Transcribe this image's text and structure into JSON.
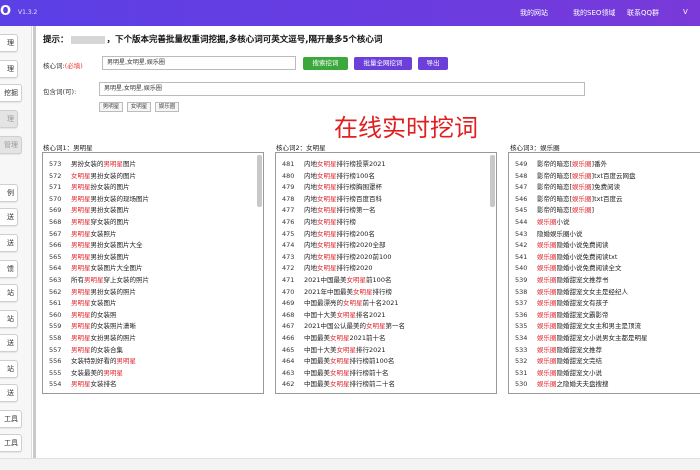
{
  "topbar": {
    "logo": "O",
    "version": "V1.3.2",
    "nav": [
      "我的网站",
      "我的SEO领域",
      "联系QQ群",
      "V"
    ]
  },
  "sidebar": {
    "labels": [
      "理",
      "理",
      "挖掘",
      "理",
      "管理",
      "例",
      "送",
      "送",
      "馈",
      "站",
      "站",
      "送",
      "站",
      "送",
      "工具",
      "工具"
    ]
  },
  "tip": {
    "prefix": "提示：",
    "text": "，下个版本完善批量权重词挖掘,多核心词可英文逗号,隔开最多5个核心词"
  },
  "form": {
    "core_label": "核心词:",
    "core_required": "(必填)",
    "core_value": "男明星,女明星,娱乐圈",
    "btn_search": "搜索挖词",
    "btn_batch": "批量全网挖词",
    "btn_export": "导出",
    "include_label": "包含词(可):",
    "include_value": "男明星,女明星,娱乐圈",
    "chips": [
      "男明星",
      "女明星",
      "娱乐圈"
    ]
  },
  "overlay_text": "在线实时挖词",
  "columns": [
    {
      "title": "核心词1：男明星",
      "rows": [
        {
          "n": "573",
          "parts": [
            {
              "t": "男扮女装的"
            },
            {
              "t": "男明星",
              "hl": true
            },
            {
              "t": "图片"
            }
          ]
        },
        {
          "n": "572",
          "parts": [
            {
              "t": "女明星",
              "hl": true
            },
            {
              "t": "男扮女装的图片"
            }
          ]
        },
        {
          "n": "571",
          "parts": [
            {
              "t": "男明星",
              "hl": true
            },
            {
              "t": "扮女装的图片"
            }
          ]
        },
        {
          "n": "570",
          "parts": [
            {
              "t": "男明星",
              "hl": true
            },
            {
              "t": "男扮女装的现场图片"
            }
          ]
        },
        {
          "n": "569",
          "parts": [
            {
              "t": "男明星",
              "hl": true
            },
            {
              "t": "男扮女装图片"
            }
          ]
        },
        {
          "n": "568",
          "parts": [
            {
              "t": "男明星",
              "hl": true
            },
            {
              "t": "穿女装的图片"
            }
          ]
        },
        {
          "n": "567",
          "parts": [
            {
              "t": "男明星",
              "hl": true
            },
            {
              "t": "女装照片"
            }
          ]
        },
        {
          "n": "566",
          "parts": [
            {
              "t": "男明星",
              "hl": true
            },
            {
              "t": "男扮女装图片大全"
            }
          ]
        },
        {
          "n": "565",
          "parts": [
            {
              "t": "男明星",
              "hl": true
            },
            {
              "t": "男扮女装图片"
            }
          ]
        },
        {
          "n": "564",
          "parts": [
            {
              "t": "男明星",
              "hl": true
            },
            {
              "t": "女装图片大全图片"
            }
          ]
        },
        {
          "n": "563",
          "parts": [
            {
              "t": "所有"
            },
            {
              "t": "男明星",
              "hl": true
            },
            {
              "t": "穿上女装的照片"
            }
          ]
        },
        {
          "n": "562",
          "parts": [
            {
              "t": "男明星",
              "hl": true
            },
            {
              "t": "男扮女装的照片"
            }
          ]
        },
        {
          "n": "561",
          "parts": [
            {
              "t": "男明星",
              "hl": true
            },
            {
              "t": "女装图片"
            }
          ]
        },
        {
          "n": "560",
          "parts": [
            {
              "t": "男明星",
              "hl": true
            },
            {
              "t": "的女装照"
            }
          ]
        },
        {
          "n": "559",
          "parts": [
            {
              "t": "男明星",
              "hl": true
            },
            {
              "t": "的女装照片潇晰"
            }
          ]
        },
        {
          "n": "558",
          "parts": [
            {
              "t": "男明星",
              "hl": true
            },
            {
              "t": "女扮男装的照片"
            }
          ]
        },
        {
          "n": "557",
          "parts": [
            {
              "t": "男明星",
              "hl": true
            },
            {
              "t": "的女装合集"
            }
          ]
        },
        {
          "n": "556",
          "parts": [
            {
              "t": "女装特别好看的"
            },
            {
              "t": "男明星",
              "hl": true
            }
          ]
        },
        {
          "n": "555",
          "parts": [
            {
              "t": "女装最美的"
            },
            {
              "t": "男明星",
              "hl": true
            }
          ]
        },
        {
          "n": "554",
          "parts": [
            {
              "t": "男明星",
              "hl": true
            },
            {
              "t": "女装排名"
            }
          ]
        }
      ]
    },
    {
      "title": "核心词2：女明星",
      "rows": [
        {
          "n": "481",
          "parts": [
            {
              "t": "内地"
            },
            {
              "t": "女明星",
              "hl": true
            },
            {
              "t": "排行榜投票2021"
            }
          ]
        },
        {
          "n": "480",
          "parts": [
            {
              "t": "内地"
            },
            {
              "t": "女明星",
              "hl": true
            },
            {
              "t": "排行榜100名"
            }
          ]
        },
        {
          "n": "479",
          "parts": [
            {
              "t": "内地"
            },
            {
              "t": "女明星",
              "hl": true
            },
            {
              "t": "排行榜胸围罩杯"
            }
          ]
        },
        {
          "n": "478",
          "parts": [
            {
              "t": "内地"
            },
            {
              "t": "女明星",
              "hl": true
            },
            {
              "t": "排行榜百度百科"
            }
          ]
        },
        {
          "n": "477",
          "parts": [
            {
              "t": "内地"
            },
            {
              "t": "女明星",
              "hl": true
            },
            {
              "t": "排行榜第一名"
            }
          ]
        },
        {
          "n": "476",
          "parts": [
            {
              "t": "内地"
            },
            {
              "t": "女明星",
              "hl": true
            },
            {
              "t": "排行榜"
            }
          ]
        },
        {
          "n": "475",
          "parts": [
            {
              "t": "内地"
            },
            {
              "t": "女明星",
              "hl": true
            },
            {
              "t": "排行榜200名"
            }
          ]
        },
        {
          "n": "474",
          "parts": [
            {
              "t": "内地"
            },
            {
              "t": "女明星",
              "hl": true
            },
            {
              "t": "排行榜2020全部"
            }
          ]
        },
        {
          "n": "473",
          "parts": [
            {
              "t": "内地"
            },
            {
              "t": "女明星",
              "hl": true
            },
            {
              "t": "排行榜2020前100"
            }
          ]
        },
        {
          "n": "472",
          "parts": [
            {
              "t": "内地"
            },
            {
              "t": "女明星",
              "hl": true
            },
            {
              "t": "排行榜2020"
            }
          ]
        },
        {
          "n": "471",
          "parts": [
            {
              "t": "2021中国最美"
            },
            {
              "t": "女明星",
              "hl": true
            },
            {
              "t": "前100名"
            }
          ]
        },
        {
          "n": "470",
          "parts": [
            {
              "t": "2021年中国最美"
            },
            {
              "t": "女明星",
              "hl": true
            },
            {
              "t": "排行榜"
            }
          ]
        },
        {
          "n": "469",
          "parts": [
            {
              "t": "中国最漂亮的"
            },
            {
              "t": "女明星",
              "hl": true
            },
            {
              "t": "前十名2021"
            }
          ]
        },
        {
          "n": "468",
          "parts": [
            {
              "t": "中国十大美"
            },
            {
              "t": "女明星",
              "hl": true
            },
            {
              "t": "排名2021"
            }
          ]
        },
        {
          "n": "467",
          "parts": [
            {
              "t": "2021中国公认最美的"
            },
            {
              "t": "女明星",
              "hl": true
            },
            {
              "t": "第一名"
            }
          ]
        },
        {
          "n": "466",
          "parts": [
            {
              "t": "中国最美"
            },
            {
              "t": "女明星",
              "hl": true
            },
            {
              "t": "2021前十名"
            }
          ]
        },
        {
          "n": "465",
          "parts": [
            {
              "t": "中国十大美"
            },
            {
              "t": "女明星",
              "hl": true
            },
            {
              "t": "排行2021"
            }
          ]
        },
        {
          "n": "464",
          "parts": [
            {
              "t": "中国最美"
            },
            {
              "t": "女明星",
              "hl": true
            },
            {
              "t": "排行榜前100名"
            }
          ]
        },
        {
          "n": "463",
          "parts": [
            {
              "t": "中国最美"
            },
            {
              "t": "女明星",
              "hl": true
            },
            {
              "t": "排行榜前十名"
            }
          ]
        },
        {
          "n": "462",
          "parts": [
            {
              "t": "中国最美"
            },
            {
              "t": "女明星",
              "hl": true
            },
            {
              "t": "排行榜前二十名"
            }
          ]
        }
      ]
    },
    {
      "title": "核心词3：娱乐圈",
      "rows": [
        {
          "n": "549",
          "parts": [
            {
              "t": "影帝的暗恋["
            },
            {
              "t": "娱乐圈",
              "hl": true
            },
            {
              "t": "]番外"
            }
          ]
        },
        {
          "n": "548",
          "parts": [
            {
              "t": "影帝的暗恋["
            },
            {
              "t": "娱乐圈",
              "hl": true
            },
            {
              "t": "]txt百度云网盘"
            }
          ]
        },
        {
          "n": "547",
          "parts": [
            {
              "t": "影帝的暗恋["
            },
            {
              "t": "娱乐圈",
              "hl": true
            },
            {
              "t": "]免费阅读"
            }
          ]
        },
        {
          "n": "546",
          "parts": [
            {
              "t": "影帝的暗恋["
            },
            {
              "t": "娱乐圈",
              "hl": true
            },
            {
              "t": "]txt百度云"
            }
          ]
        },
        {
          "n": "545",
          "parts": [
            {
              "t": "影帝的暗恋["
            },
            {
              "t": "娱乐圈",
              "hl": true
            },
            {
              "t": "]"
            }
          ]
        },
        {
          "n": "544",
          "parts": [
            {
              "t": "娱乐圈",
              "hl": true
            },
            {
              "t": "小说"
            }
          ]
        },
        {
          "n": "543",
          "parts": [
            {
              "t": "隐婚娱乐圈小说",
              "hlfirst": true
            }
          ]
        },
        {
          "n": "542",
          "parts": [
            {
              "t": "娱乐圈",
              "hl": true
            },
            {
              "t": "隐婚小说免费阅读"
            }
          ]
        },
        {
          "n": "541",
          "parts": [
            {
              "t": "娱乐圈",
              "hl": true
            },
            {
              "t": "隐婚小说免费阅读txt"
            }
          ]
        },
        {
          "n": "540",
          "parts": [
            {
              "t": "娱乐圈",
              "hl": true
            },
            {
              "t": "隐婚小说免费阅读全文"
            }
          ]
        },
        {
          "n": "539",
          "parts": [
            {
              "t": "娱乐圈",
              "hl": true
            },
            {
              "t": "隐婚甜宠文推荐书"
            }
          ]
        },
        {
          "n": "538",
          "parts": [
            {
              "t": "娱乐圈",
              "hl": true
            },
            {
              "t": "隐婚甜宠文女主是经纪人"
            }
          ]
        },
        {
          "n": "537",
          "parts": [
            {
              "t": "娱乐圈",
              "hl": true
            },
            {
              "t": "隐婚甜宠文有孩子"
            }
          ]
        },
        {
          "n": "536",
          "parts": [
            {
              "t": "娱乐圈",
              "hl": true
            },
            {
              "t": "隐婚甜宠文霸影帝"
            }
          ]
        },
        {
          "n": "535",
          "parts": [
            {
              "t": "娱乐圈",
              "hl": true
            },
            {
              "t": "隐婚甜宠文女主和男主是顶流"
            }
          ]
        },
        {
          "n": "534",
          "parts": [
            {
              "t": "娱乐圈",
              "hl": true
            },
            {
              "t": "隐婚甜宠文小说男女主都是明星"
            }
          ]
        },
        {
          "n": "533",
          "parts": [
            {
              "t": "娱乐圈",
              "hl": true
            },
            {
              "t": "隐婚甜宠文推荐"
            }
          ]
        },
        {
          "n": "532",
          "parts": [
            {
              "t": "娱乐圈",
              "hl": true
            },
            {
              "t": "隐婚甜宠文完结"
            }
          ]
        },
        {
          "n": "531",
          "parts": [
            {
              "t": "娱乐圈",
              "hl": true
            },
            {
              "t": "隐婚甜宠文小说"
            }
          ]
        },
        {
          "n": "530",
          "parts": [
            {
              "t": "娱乐圈",
              "hl": true
            },
            {
              "t": "之隐婚夫夫盘搜搜"
            }
          ]
        }
      ]
    }
  ]
}
